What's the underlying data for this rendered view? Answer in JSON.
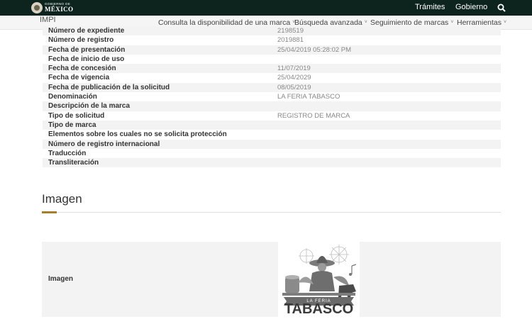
{
  "gov_bar": {
    "logo_small": "GOBIERNO DE",
    "logo_big": "MÉXICO",
    "links": [
      "Trámites",
      "Gobierno"
    ],
    "search_icon": "search-icon"
  },
  "nav": {
    "brand": "IMPI",
    "items": [
      "Consulta la disponibilidad de una marca",
      "Búsqueda avanzada",
      "Seguimiento de marcas",
      "Herramientas"
    ]
  },
  "details": [
    {
      "label": "Número de expediente",
      "value": "2198519"
    },
    {
      "label": "Número de registro",
      "value": "2019881"
    },
    {
      "label": "Fecha de presentación",
      "value": "25/04/2019 05:28:02 PM"
    },
    {
      "label": "Fecha de inicio de uso",
      "value": ""
    },
    {
      "label": "Fecha de concesión",
      "value": "11/07/2019"
    },
    {
      "label": "Fecha de vigencia",
      "value": "25/04/2029"
    },
    {
      "label": "Fecha de publicación de la solicitud",
      "value": "08/05/2019"
    },
    {
      "label": "Denominación",
      "value": "LA FERIA TABASCO"
    },
    {
      "label": "Descripción de la marca",
      "value": ""
    },
    {
      "label": "Tipo de solicitud",
      "value": "REGISTRO DE MARCA"
    },
    {
      "label": "Tipo de marca",
      "value": ""
    },
    {
      "label": "Elementos sobre los cuales no se solicita protección",
      "value": ""
    },
    {
      "label": "Número de registro internacional",
      "value": ""
    },
    {
      "label": "Traducción",
      "value": ""
    },
    {
      "label": "Transliteración",
      "value": ""
    }
  ],
  "image_section": {
    "title": "Imagen",
    "row_label": "Imagen",
    "logo_banner": "LA FERIA",
    "logo_main": "TABASCO"
  },
  "colors": {
    "gov_bar": "#0c231e",
    "accent": "#a57f2c"
  }
}
